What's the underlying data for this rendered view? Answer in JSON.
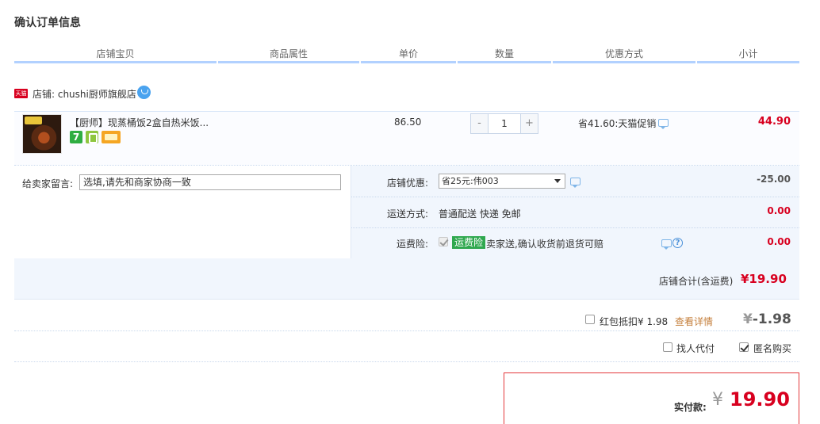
{
  "page": {
    "title": "确认订单信息"
  },
  "columns": [
    "店铺宝贝",
    "商品属性",
    "单价",
    "数量",
    "优惠方式",
    "小计"
  ],
  "shop": {
    "badge": "天猫",
    "label": "店铺: chushi厨师旗舰店"
  },
  "item": {
    "title": "【厨师】现蒸桶饭2盒自热米饭...",
    "service_badge": "7",
    "unit_price": "86.50",
    "quantity": "1",
    "qty_minus": "-",
    "qty_plus": "+",
    "promo": "省41.60:天猫促销",
    "subtotal": "44.90"
  },
  "message": {
    "label": "给卖家留言:",
    "placeholder": "选填,请先和商家协商一致"
  },
  "coupon": {
    "label": "店铺优惠:",
    "selected": "省25元:伟003",
    "amount": "-25.00"
  },
  "shipping": {
    "label": "运送方式:",
    "value": "普通配送 快递 免邮",
    "amount": "0.00"
  },
  "insurance": {
    "label": "运费险:",
    "badge": "运费险",
    "desc": "卖家送,确认收货前退货可赔",
    "amount": "0.00",
    "help": "?"
  },
  "shop_total": {
    "label": "店铺合计(含运费)",
    "value": "¥19.90"
  },
  "redpack": {
    "label": "红包抵扣¥ 1.98",
    "link": "查看详情",
    "yen": "¥",
    "amount": "-1.98"
  },
  "options": {
    "proxy_pay": "找人代付",
    "anonymous": "匿名购买"
  },
  "payment": {
    "label": "实付款:",
    "yen": "¥",
    "value": "19.90"
  },
  "colors": {
    "accent_red": "#d8001f",
    "header_line": "#b2d1ff",
    "panel_bg": "#f1f6fd",
    "insurance_green": "#2fa84f",
    "link_orange": "#c47e3a"
  },
  "icons": [
    "tmall-icon",
    "wangwang-icon",
    "seven-day-return-icon",
    "tag-icon",
    "card-icon",
    "chat-icon",
    "help-icon",
    "dropdown-arrow-icon"
  ]
}
